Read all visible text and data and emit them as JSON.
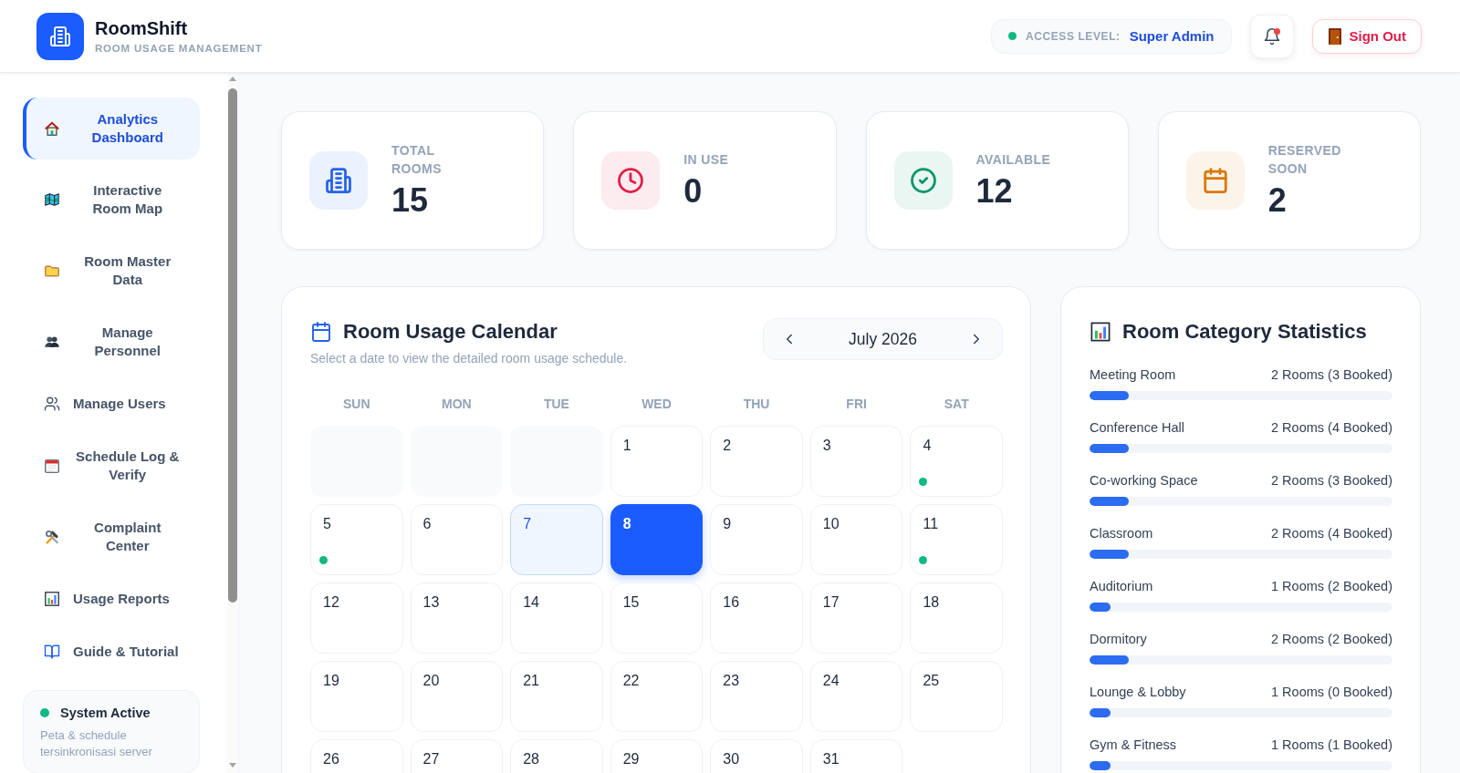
{
  "header": {
    "app_name": "RoomShift",
    "tagline": "ROOM USAGE MANAGEMENT",
    "access": {
      "label": "ACCESS LEVEL:",
      "value": "Super Admin"
    },
    "notifications": {
      "unread": true
    },
    "sign_out": "Sign Out"
  },
  "sidebar": {
    "items": [
      {
        "label": "Analytics Dashboard",
        "selected": true
      },
      {
        "label": "Interactive Room Map",
        "selected": false
      },
      {
        "label": "Room Master Data",
        "selected": false
      },
      {
        "label": "Manage Personnel",
        "selected": false
      },
      {
        "label": "Manage Users",
        "selected": false
      },
      {
        "label": "Schedule Log & Verify",
        "selected": false
      },
      {
        "label": "Complaint Center",
        "selected": false
      },
      {
        "label": "Usage Reports",
        "selected": false
      },
      {
        "label": "Guide & Tutorial",
        "selected": false
      }
    ],
    "status": {
      "title": "System Active",
      "text": "Peta & schedule tersinkronisasi server"
    }
  },
  "stats": [
    {
      "kind": "total",
      "label": "TOTAL ROOMS",
      "value": "15",
      "color": "#2563eb"
    },
    {
      "kind": "in_use",
      "label": "IN USE",
      "value": "0",
      "color": "#e11d48"
    },
    {
      "kind": "available",
      "label": "AVAILABLE",
      "value": "12",
      "color": "#059669"
    },
    {
      "kind": "reserved",
      "label": "RESERVED SOON",
      "value": "2",
      "color": "#d97706"
    }
  ],
  "calendar": {
    "title": "Room Usage Calendar",
    "subtitle": "Select a date to view the detailed room usage schedule.",
    "month": "July 2026",
    "weekdays": [
      "SUN",
      "MON",
      "TUE",
      "WED",
      "THU",
      "FRI",
      "SAT"
    ],
    "days": [
      {
        "kind": "blank",
        "selected": false,
        "today": false,
        "has_event": false
      },
      {
        "kind": "blank",
        "selected": false,
        "today": false,
        "has_event": false
      },
      {
        "kind": "blank",
        "selected": false,
        "today": false,
        "has_event": false
      },
      {
        "kind": "day",
        "day": "1",
        "selected": false,
        "today": false,
        "has_event": false
      },
      {
        "kind": "day",
        "day": "2",
        "selected": false,
        "today": false,
        "has_event": false
      },
      {
        "kind": "day",
        "day": "3",
        "selected": false,
        "today": false,
        "has_event": false
      },
      {
        "kind": "day",
        "day": "4",
        "selected": false,
        "today": false,
        "has_event": true
      },
      {
        "kind": "day",
        "day": "5",
        "selected": false,
        "today": false,
        "has_event": true
      },
      {
        "kind": "day",
        "day": "6",
        "selected": false,
        "today": false,
        "has_event": false
      },
      {
        "kind": "day",
        "day": "7",
        "selected": false,
        "today": true,
        "has_event": false
      },
      {
        "kind": "day",
        "day": "8",
        "selected": true,
        "today": false,
        "has_event": false
      },
      {
        "kind": "day",
        "day": "9",
        "selected": false,
        "today": false,
        "has_event": false
      },
      {
        "kind": "day",
        "day": "10",
        "selected": false,
        "today": false,
        "has_event": false
      },
      {
        "kind": "day",
        "day": "11",
        "selected": false,
        "today": false,
        "has_event": true
      },
      {
        "kind": "day",
        "day": "12",
        "selected": false,
        "today": false,
        "has_event": false
      },
      {
        "kind": "day",
        "day": "13",
        "selected": false,
        "today": false,
        "has_event": false
      },
      {
        "kind": "day",
        "day": "14",
        "selected": false,
        "today": false,
        "has_event": false
      },
      {
        "kind": "day",
        "day": "15",
        "selected": false,
        "today": false,
        "has_event": false
      },
      {
        "kind": "day",
        "day": "16",
        "selected": false,
        "today": false,
        "has_event": false
      },
      {
        "kind": "day",
        "day": "17",
        "selected": false,
        "today": false,
        "has_event": false
      },
      {
        "kind": "day",
        "day": "18",
        "selected": false,
        "today": false,
        "has_event": false
      },
      {
        "kind": "day",
        "day": "19",
        "selected": false,
        "today": false,
        "has_event": false
      },
      {
        "kind": "day",
        "day": "20",
        "selected": false,
        "today": false,
        "has_event": false
      },
      {
        "kind": "day",
        "day": "21",
        "selected": false,
        "today": false,
        "has_event": false
      },
      {
        "kind": "day",
        "day": "22",
        "selected": false,
        "today": false,
        "has_event": false
      },
      {
        "kind": "day",
        "day": "23",
        "selected": false,
        "today": false,
        "has_event": false
      },
      {
        "kind": "day",
        "day": "24",
        "selected": false,
        "today": false,
        "has_event": false
      },
      {
        "kind": "day",
        "day": "25",
        "selected": false,
        "today": false,
        "has_event": false
      },
      {
        "kind": "day",
        "day": "26",
        "selected": false,
        "today": false,
        "has_event": false
      },
      {
        "kind": "day",
        "day": "27",
        "selected": false,
        "today": false,
        "has_event": false
      },
      {
        "kind": "day",
        "day": "28",
        "selected": false,
        "today": false,
        "has_event": false
      },
      {
        "kind": "day",
        "day": "29",
        "selected": false,
        "today": false,
        "has_event": false
      },
      {
        "kind": "day",
        "day": "30",
        "selected": false,
        "today": false,
        "has_event": false
      },
      {
        "kind": "day",
        "day": "31",
        "selected": false,
        "today": false,
        "has_event": false
      }
    ]
  },
  "category_stats": {
    "title": "Room Category Statistics",
    "categories": [
      {
        "name": "Meeting Room",
        "summary": "2 Rooms (3 Booked)",
        "level": 0.13
      },
      {
        "name": "Conference Hall",
        "summary": "2 Rooms (4 Booked)",
        "level": 0.13
      },
      {
        "name": "Co-working Space",
        "summary": "2 Rooms (3 Booked)",
        "level": 0.13
      },
      {
        "name": "Classroom",
        "summary": "2 Rooms (4 Booked)",
        "level": 0.13
      },
      {
        "name": "Auditorium",
        "summary": "1 Rooms (2 Booked)",
        "level": 0.07
      },
      {
        "name": "Dormitory",
        "summary": "2 Rooms (2 Booked)",
        "level": 0.13
      },
      {
        "name": "Lounge & Lobby",
        "summary": "1 Rooms (0 Booked)",
        "level": 0.07
      },
      {
        "name": "Gym & Fitness",
        "summary": "1 Rooms (1 Booked)",
        "level": 0.07
      }
    ]
  }
}
